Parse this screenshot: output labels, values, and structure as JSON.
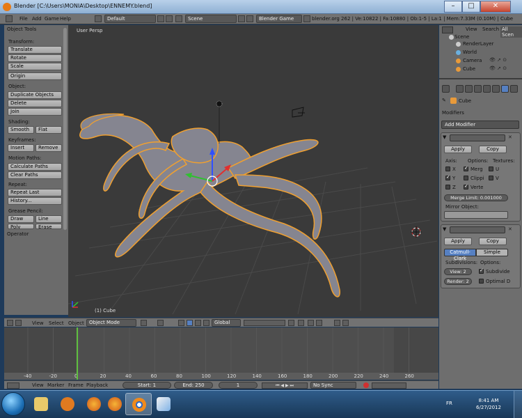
{
  "window": {
    "title": "Blender [C:\\Users\\MONIA\\Desktop\\ENNEMY.blend]",
    "minimize": "–",
    "maximize": "□",
    "close": "✕"
  },
  "info_header": {
    "menus": [
      "File",
      "Add",
      "Game",
      "Help"
    ],
    "layout": "Default",
    "scene": "Scene",
    "engine": "Blender Game",
    "stats": "blender.org 262 | Ve:10822 | Fa:10880 | Ob:1-5 | La:1 | Mem:7.33M (0.10M) | Cube"
  },
  "tool_shelf": {
    "title": "Object Tools",
    "transform_label": "Transform:",
    "translate": "Translate",
    "rotate": "Rotate",
    "scale": "Scale",
    "origin": "Origin",
    "object_label": "Object:",
    "duplicate": "Duplicate Objects",
    "delete": "Delete",
    "join": "Join",
    "shading_label": "Shading:",
    "smooth": "Smooth",
    "flat": "Flat",
    "keyframes_label": "Keyframes:",
    "insert": "Insert",
    "remove": "Remove",
    "motion_label": "Motion Paths:",
    "calculate_paths": "Calculate Paths",
    "clear_paths": "Clear Paths",
    "repeat_label": "Repeat:",
    "repeat_last": "Repeat Last",
    "history": "History...",
    "grease_label": "Grease Pencil:",
    "draw": "Draw",
    "line": "Line",
    "poly": "Poly",
    "erase": "Erase",
    "operator": "Operator"
  },
  "viewport": {
    "view_label": "User Persp",
    "object_label": "(1) Cube"
  },
  "view3d_header": {
    "view": "View",
    "select": "Select",
    "object": "Object",
    "mode": "Object Mode",
    "orientation": "Global"
  },
  "timeline": {
    "ticks": [
      "-40",
      "-20",
      "0",
      "20",
      "40",
      "60",
      "80",
      "100",
      "120",
      "140",
      "160",
      "180",
      "200",
      "220",
      "240",
      "260"
    ],
    "current_frame_value": 1,
    "menus": [
      "View",
      "Marker",
      "Frame",
      "Playback"
    ],
    "start": "Start: 1",
    "end": "End: 250",
    "frame": "1",
    "sync": "No Sync"
  },
  "outliner": {
    "view": "View",
    "search": "Search",
    "all_scenes": "All Scen",
    "items": [
      "Scene",
      "RenderLayer",
      "World",
      "Camera",
      "Cube"
    ]
  },
  "properties": {
    "object_name": "Cube",
    "modifiers_title": "Modifiers",
    "add_modifier": "Add Modifier",
    "mirror": {
      "apply": "Apply",
      "copy": "Copy",
      "axis_label": "Axis:",
      "options_label": "Options:",
      "textures_label": "Textures:",
      "x": "X",
      "y": "Y",
      "z": "Z",
      "merge": "Merg",
      "clipping": "Clippi",
      "vertex": "Verte",
      "u": "U",
      "v": "V",
      "merge_limit": "Merge Limit: 0.001000",
      "mirror_object_label": "Mirror Object:"
    },
    "subsurf": {
      "apply": "Apply",
      "copy": "Copy",
      "catmull": "Catmull-Clark",
      "simple": "Simple",
      "subdivisions_label": "Subdivisions:",
      "options_label": "Options:",
      "view": "View: 2",
      "render": "Render: 2",
      "subdivide_uvs": "Subdivide",
      "optimal": "Optimal D"
    }
  },
  "taskbar": {
    "language": "FR",
    "time": "8:41 AM",
    "date": "6/27/2012"
  },
  "colors": {
    "accent": "#5680c2",
    "selection_outline": "#f0a030",
    "current_frame": "#60c040"
  }
}
